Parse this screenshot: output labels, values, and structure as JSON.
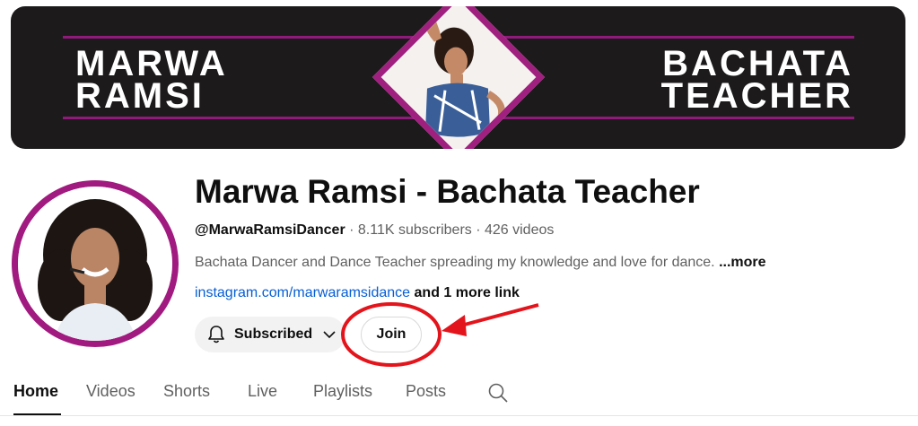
{
  "banner": {
    "left_text": "MARWA\nRAMSI",
    "right_text": "BACHATA\nTEACHER",
    "colors": {
      "background": "#1c1a1b",
      "accent": "#a0207f"
    }
  },
  "channel": {
    "title": "Marwa Ramsi - Bachata Teacher",
    "handle": "@MarwaRamsiDancer",
    "separator1": " · ",
    "subscribers": "8.11K subscribers",
    "separator2": " · ",
    "videos": "426 videos",
    "description": "Bachata Dancer and Dance Teacher spreading my knowledge and love for dance. ",
    "more_label": "...more",
    "link": "instagram.com/marwaramsidance",
    "extra_links": " and 1 more link"
  },
  "actions": {
    "subscribed_label": "Subscribed",
    "join_label": "Join",
    "bell_icon": "bell-icon",
    "chevron_icon": "chevron-down-icon"
  },
  "annotation": {
    "color": "#e3141b"
  },
  "tabs": [
    {
      "label": "Home",
      "active": true
    },
    {
      "label": "Videos",
      "active": false
    },
    {
      "label": "Shorts",
      "active": false
    },
    {
      "label": "Live",
      "active": false
    },
    {
      "label": "Playlists",
      "active": false
    },
    {
      "label": "Posts",
      "active": false
    }
  ],
  "search_icon": "search-icon"
}
